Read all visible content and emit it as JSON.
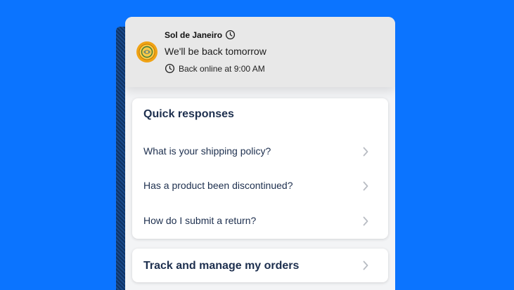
{
  "colors": {
    "background": "#0b74ff",
    "header_bg": "#e8e8e8",
    "card_bg": "#ffffff",
    "text_navy": "#1d2f4e",
    "avatar": "#f0a315",
    "chevron": "#b8bcc3"
  },
  "header": {
    "store_name": "Sol de Janeiro",
    "store_icon": "clock-icon",
    "status_title": "We'll be back tomorrow",
    "online_icon": "clock-icon",
    "online_text": "Back online at 9:00 AM",
    "avatar_icon": "brand-logo-icon"
  },
  "quick_responses": {
    "title": "Quick responses",
    "items": [
      {
        "label": "What is your shipping policy?",
        "icon": "chevron-right-icon"
      },
      {
        "label": "Has a product been discontinued?",
        "icon": "chevron-right-icon"
      },
      {
        "label": "How do I submit a return?",
        "icon": "chevron-right-icon"
      }
    ]
  },
  "orders": {
    "label": "Track and manage my orders",
    "icon": "chevron-right-icon"
  }
}
